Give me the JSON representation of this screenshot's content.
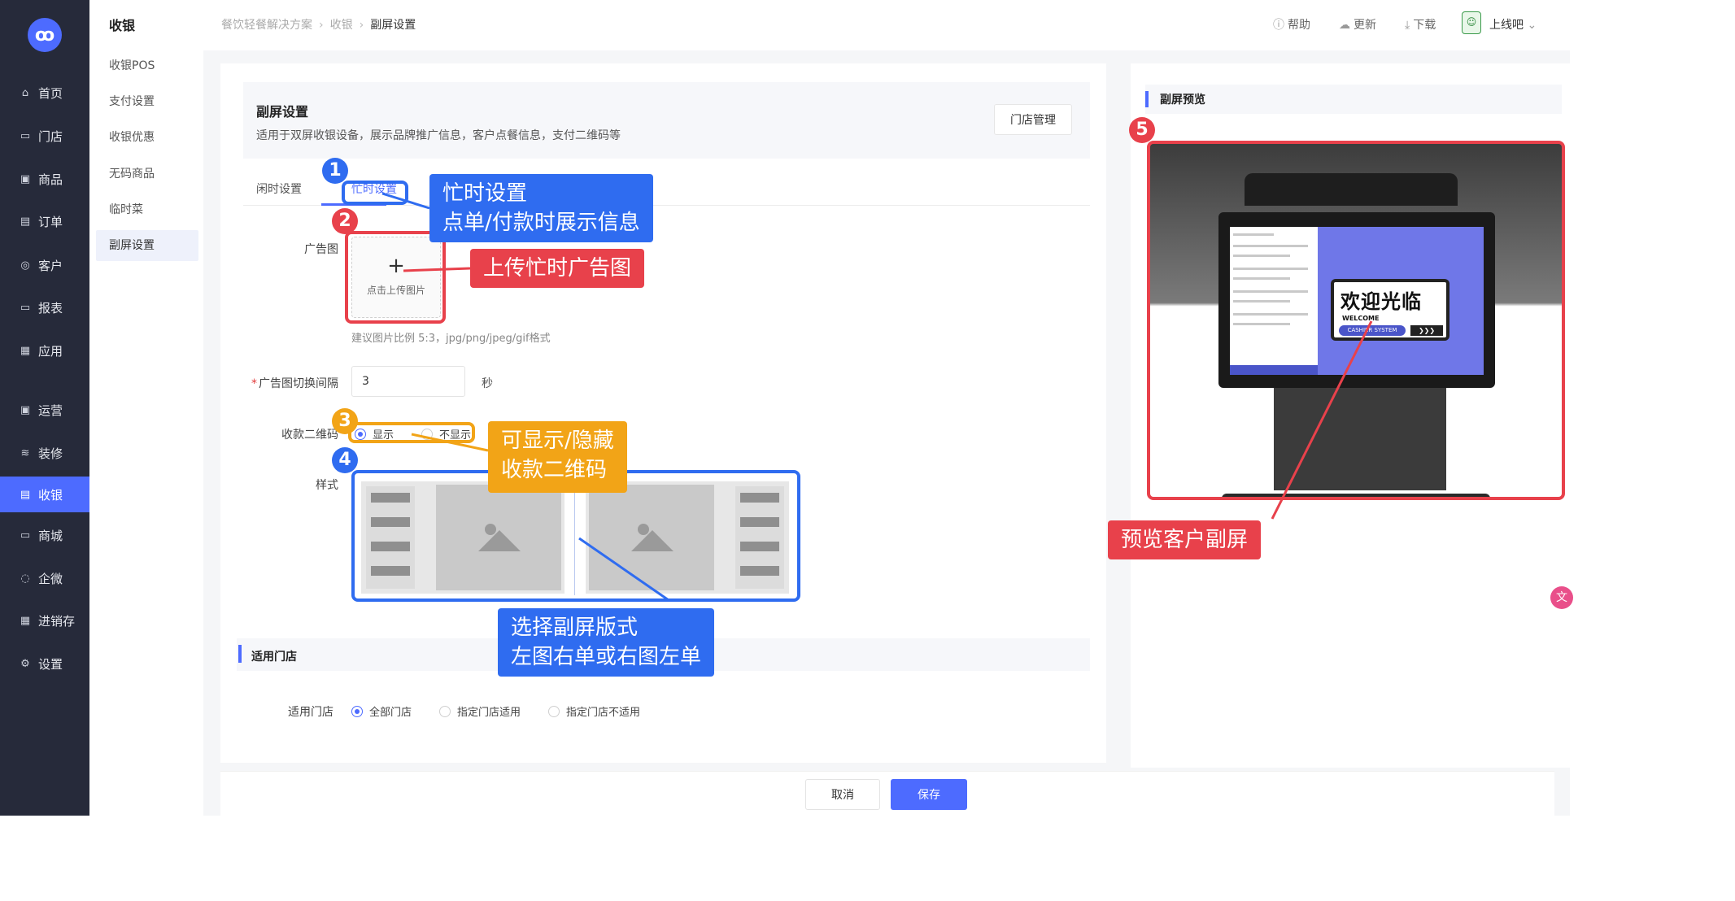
{
  "nav": {
    "logo_icon": "brand-logo-icon",
    "items": [
      {
        "label": "首页",
        "icon": "home-icon",
        "glyph": "⌂"
      },
      {
        "label": "门店",
        "icon": "store-icon",
        "glyph": "▭"
      },
      {
        "label": "商品",
        "icon": "bag-icon",
        "glyph": "▣"
      },
      {
        "label": "订单",
        "icon": "order-icon",
        "glyph": "▤"
      },
      {
        "label": "客户",
        "icon": "user-icon",
        "glyph": "◎"
      },
      {
        "label": "报表",
        "icon": "report-icon",
        "glyph": "▭"
      },
      {
        "label": "应用",
        "icon": "apps-icon",
        "glyph": "▦"
      },
      {
        "label": "运营",
        "icon": "operation-icon",
        "glyph": "▣"
      },
      {
        "label": "装修",
        "icon": "decorate-icon",
        "glyph": "≋"
      },
      {
        "label": "收银",
        "icon": "cashier-icon",
        "glyph": "▤"
      },
      {
        "label": "商城",
        "icon": "mall-icon",
        "glyph": "▭"
      },
      {
        "label": "企微",
        "icon": "wecom-icon",
        "glyph": "◌"
      },
      {
        "label": "进销存",
        "icon": "inventory-icon",
        "glyph": "▦"
      },
      {
        "label": "设置",
        "icon": "settings-icon",
        "glyph": "⚙"
      }
    ]
  },
  "subnav": {
    "title": "收银",
    "items": [
      "收银POS",
      "支付设置",
      "收银优惠",
      "无码商品",
      "临时菜",
      "副屏设置"
    ]
  },
  "breadcrumb": [
    "餐饮轻餐解决方案",
    "收银",
    "副屏设置"
  ],
  "topbar": {
    "help": "帮助",
    "update": "更新",
    "download": "下载",
    "user": "上线吧"
  },
  "header": {
    "title": "副屏设置",
    "desc": "适用于双屏收银设备，展示品牌推广信息，客户点餐信息，支付二维码等",
    "store_button": "门店管理"
  },
  "tabs": {
    "idle": "闲时设置",
    "busy": "忙时设置"
  },
  "form": {
    "ad_label": "广告图",
    "upload_plus": "+",
    "upload_text": "点击上传图片",
    "hint": "建议图片比例 5:3，jpg/png/jpeg/gif格式",
    "interval_label": "广告图切换间隔",
    "required_mark": "*",
    "interval_value": "3",
    "interval_unit": "秒",
    "qr_label": "收款二维码",
    "qr_show": "显示",
    "qr_hide": "不显示",
    "style_label": "样式"
  },
  "stores": {
    "section_title": "适用门店",
    "label": "适用门店",
    "options": [
      "全部门店",
      "指定门店适用",
      "指定门店不适用"
    ],
    "selected": "全部门店"
  },
  "footer": {
    "cancel": "取消",
    "save": "保存"
  },
  "preview": {
    "title": "副屏预览",
    "welcome_cn": "欢迎光临",
    "welcome_en": "WELCOME",
    "cashier_system": "CASHIER SYSTEM",
    "chevrons": "❯❯❯"
  },
  "annotations": {
    "n1": "1",
    "n2": "2",
    "n3": "3",
    "n4": "4",
    "n5": "5",
    "busy_setting": "忙时设置",
    "busy_setting_sub": "点单/付款时展示信息",
    "upload_busy_ad": "上传忙时广告图",
    "toggle_qr": "可显示/隐藏",
    "toggle_qr_sub": "收款二维码",
    "choose_layout": "选择副屏版式",
    "choose_layout_sub": "左图右单或右图左单",
    "preview_screen": "预览客户副屏"
  },
  "colors": {
    "accent": "#4d6bff",
    "annot_blue": "#2f6cf0",
    "annot_red": "#e8414b",
    "annot_orange": "#f2a417",
    "sidebar": "#262a3a"
  }
}
